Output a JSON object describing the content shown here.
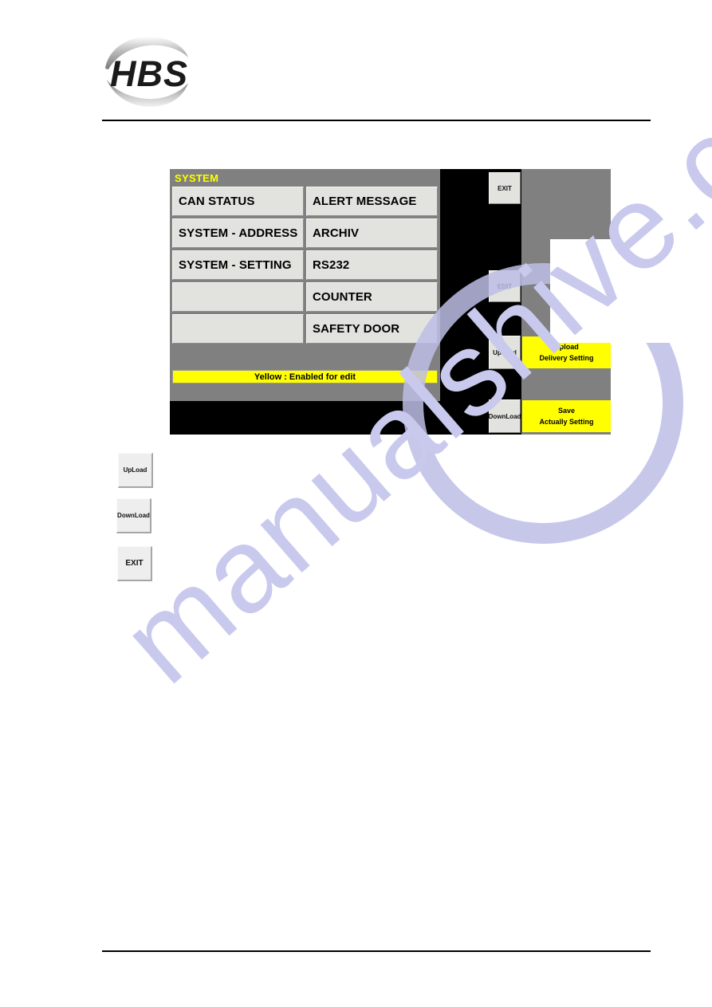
{
  "page": {
    "background_color": "#ffffff",
    "rule_color": "#000000"
  },
  "logo": {
    "name": "HBS",
    "alt": "HBS logo"
  },
  "watermark": {
    "text": "manualshive.com"
  },
  "hmi": {
    "title": "SYSTEM",
    "colors": {
      "panel_background": "#000000",
      "panel_grey": "#808080",
      "button_face": "#e2e2de",
      "accent_yellow": "#ffff00",
      "title_color": "#ffff00"
    },
    "menu_rows": [
      {
        "left": "CAN STATUS",
        "right": "ALERT MESSAGE"
      },
      {
        "left": "SYSTEM - ADDRESS",
        "right": "ARCHIV"
      },
      {
        "left": "SYSTEM - SETTING",
        "right": "RS232"
      },
      {
        "left": "",
        "right": "COUNTER"
      },
      {
        "left": "",
        "right": "SAFETY DOOR"
      }
    ],
    "legend_bar": "Yellow : Enabled for edit",
    "side_buttons": {
      "exit": "EXIT",
      "edit": "EDIT",
      "upload": "UpLoad",
      "download": "DownLoad"
    },
    "bands": {
      "upload": {
        "line1": "Upload",
        "line2": "Delivery Setting"
      },
      "save": {
        "line1": "Save",
        "line2": "Actually Setting"
      }
    }
  },
  "legend_buttons": [
    {
      "label": "UpLoad"
    },
    {
      "label": "DownLoad"
    },
    {
      "label": "EXIT"
    }
  ]
}
